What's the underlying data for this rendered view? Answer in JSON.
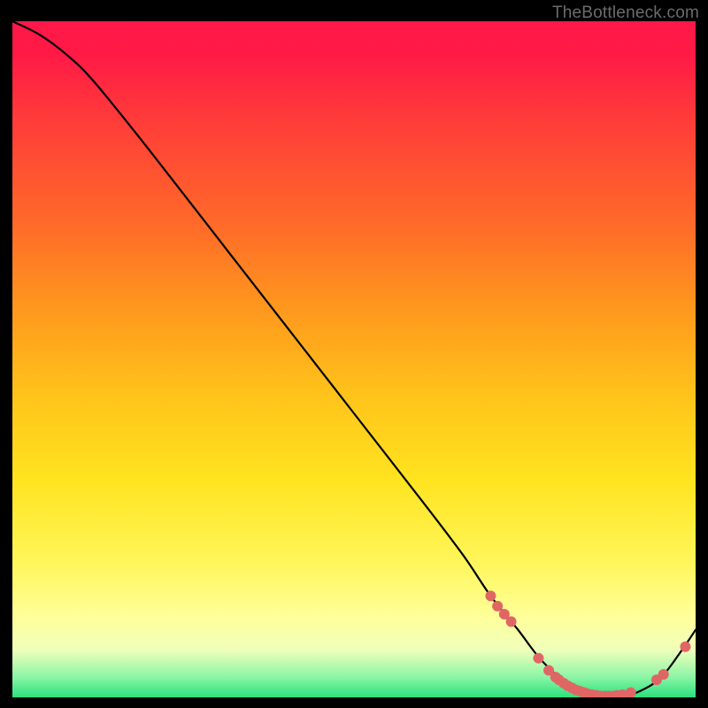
{
  "watermark": "TheBottleneck.com",
  "chart_data": {
    "type": "line",
    "title": "",
    "xlabel": "",
    "ylabel": "",
    "xlim": [
      0,
      100
    ],
    "ylim": [
      0,
      100
    ],
    "grid": false,
    "legend": false,
    "series": [
      {
        "name": "curve",
        "color": "#000000",
        "x": [
          0,
          4,
          8,
          12,
          20,
          30,
          40,
          50,
          60,
          66,
          70,
          74,
          77,
          80,
          83,
          86,
          89,
          92,
          95,
          98,
          100
        ],
        "y": [
          100,
          98,
          95,
          91,
          81,
          68,
          55,
          42,
          29,
          21,
          15,
          10,
          6,
          3,
          1,
          0,
          0,
          1,
          3,
          7,
          10
        ]
      }
    ],
    "markers": {
      "name": "highlight-dots",
      "color": "#e06666",
      "radius": 6,
      "points": [
        {
          "x": 70.0,
          "y": 15.0
        },
        {
          "x": 71.0,
          "y": 13.5
        },
        {
          "x": 72.0,
          "y": 12.3
        },
        {
          "x": 73.0,
          "y": 11.2
        },
        {
          "x": 77.0,
          "y": 5.8
        },
        {
          "x": 78.5,
          "y": 4.0
        },
        {
          "x": 79.5,
          "y": 3.0
        },
        {
          "x": 80.0,
          "y": 2.6
        },
        {
          "x": 80.7,
          "y": 2.1
        },
        {
          "x": 81.3,
          "y": 1.7
        },
        {
          "x": 81.9,
          "y": 1.4
        },
        {
          "x": 82.5,
          "y": 1.1
        },
        {
          "x": 83.1,
          "y": 0.9
        },
        {
          "x": 83.7,
          "y": 0.7
        },
        {
          "x": 84.3,
          "y": 0.5
        },
        {
          "x": 84.9,
          "y": 0.4
        },
        {
          "x": 85.5,
          "y": 0.3
        },
        {
          "x": 86.1,
          "y": 0.2
        },
        {
          "x": 86.7,
          "y": 0.2
        },
        {
          "x": 87.3,
          "y": 0.2
        },
        {
          "x": 87.9,
          "y": 0.2
        },
        {
          "x": 88.5,
          "y": 0.3
        },
        {
          "x": 89.3,
          "y": 0.4
        },
        {
          "x": 90.5,
          "y": 0.7
        },
        {
          "x": 94.3,
          "y": 2.6
        },
        {
          "x": 95.3,
          "y": 3.4
        },
        {
          "x": 98.5,
          "y": 7.5
        }
      ]
    }
  }
}
